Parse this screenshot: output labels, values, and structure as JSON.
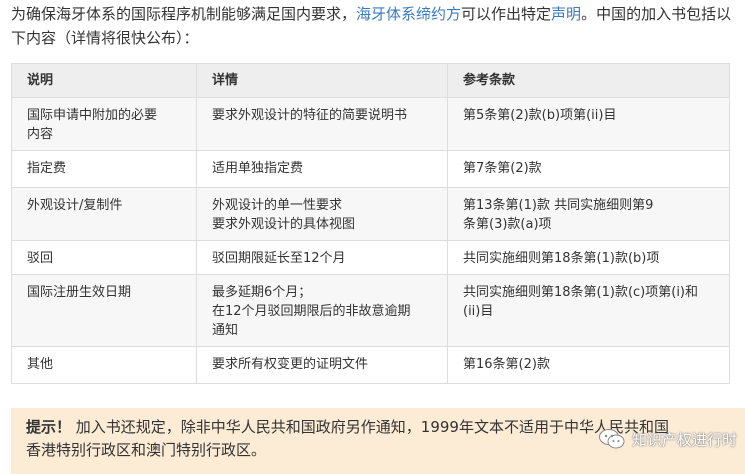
{
  "intro": {
    "part1": "为确保海牙体系的国际程序机制能够满足国内要求，",
    "link1": "海牙体系缔约方",
    "part2": "可以作出特定",
    "link2": "声明",
    "part3": "。中国的加入书包括以下内容（详情将很快公布）："
  },
  "table": {
    "headers": [
      "说明",
      "详情",
      "参考条款"
    ],
    "rows": [
      {
        "desc": [
          "国际申请中附加的必要",
          "内容"
        ],
        "detail": [
          "要求外观设计的特征的简要说明书"
        ],
        "ref": [
          "第5条第(2)款(b)项第(ii)目"
        ]
      },
      {
        "desc": [
          "指定费"
        ],
        "detail": [
          "适用单独指定费"
        ],
        "ref": [
          "第7条第(2)款"
        ]
      },
      {
        "desc": [
          "外观设计/复制件"
        ],
        "detail": [
          "外观设计的单一性要求",
          "要求外观设计的具体视图"
        ],
        "ref": [
          "第13条第(1)款 共同实施细则第9",
          "条第(3)款(a)项"
        ]
      },
      {
        "desc": [
          "驳回"
        ],
        "detail": [
          "驳回期限延长至12个月"
        ],
        "ref": [
          "共同实施细则第18条第(1)款(b)项"
        ]
      },
      {
        "desc": [
          "国际注册生效日期"
        ],
        "detail": [
          "最多延期6个月；",
          "在12个月驳回期限后的非故意逾期",
          "通知"
        ],
        "ref": [
          "共同实施细则第18条第(1)款(c)项第(i)和",
          "(ii)目"
        ]
      },
      {
        "desc": [
          "其他"
        ],
        "detail": [
          "要求所有权变更的证明文件"
        ],
        "ref": [
          "第16条第(2)款"
        ]
      }
    ]
  },
  "tip": {
    "label": "提示！",
    "line1": "加入书还规定，除非中华人民共和国政府另作通知，1999年文本不适用于中华人民共和国",
    "line2": "香港特别行政区和澳门特别行政区。"
  },
  "watermark": {
    "text": "知识产权进行时",
    "icon": "wechat-icon"
  }
}
